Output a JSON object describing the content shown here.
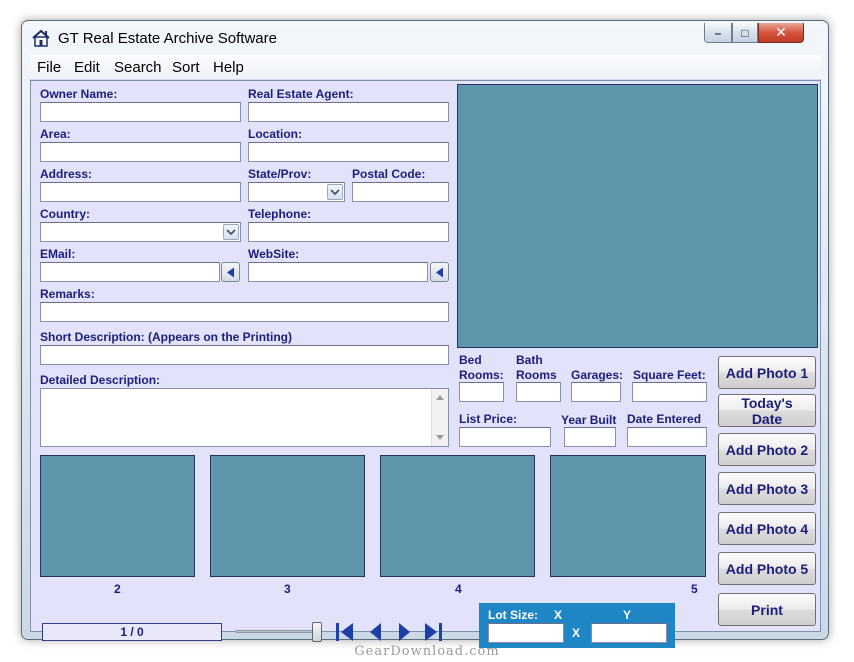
{
  "window": {
    "title": "GT Real Estate Archive Software",
    "min_glyph": "–",
    "max_glyph": "□",
    "close_glyph": "✕"
  },
  "menu": [
    "File",
    "Edit",
    "Search",
    "Sort",
    "Help"
  ],
  "fields": {
    "owner_name": "Owner Name:",
    "agent": "Real Estate Agent:",
    "area": "Area:",
    "location": "Location:",
    "address": "Address:",
    "state": "State/Prov:",
    "postal": "Postal Code:",
    "country": "Country:",
    "telephone": "Telephone:",
    "email": "EMail:",
    "website": "WebSite:",
    "remarks": "Remarks:",
    "short_desc": "Short Description:   (Appears on the Printing)",
    "detailed_desc": "Detailed Description:",
    "bed_1": "Bed",
    "bed_2": "Rooms:",
    "bath_1": "Bath",
    "bath_2": "Rooms",
    "garages": "Garages:",
    "square_feet": "Square Feet:",
    "list_price": "List Price:",
    "year_built": "Year Built",
    "date_entered": "Date Entered"
  },
  "buttons": {
    "add_photo_1": "Add Photo 1",
    "todays_date": "Today's Date",
    "add_photo_2": "Add Photo 2",
    "add_photo_3": "Add Photo 3",
    "add_photo_4": "Add Photo 4",
    "add_photo_5": "Add Photo 5",
    "print": "Print"
  },
  "thumb_numbers": [
    "2",
    "3",
    "4",
    "5"
  ],
  "record_counter": "1 / 0",
  "lot_size": {
    "label": "Lot Size:",
    "x_label": "X",
    "y_label": "Y",
    "sep": "X"
  },
  "watermark": "GearDownload.com",
  "colors": {
    "form_bg": "#e2e2fa",
    "label": "#1d1d7c",
    "photo": "#5f96ab",
    "lot_panel": "#1e86c4"
  }
}
